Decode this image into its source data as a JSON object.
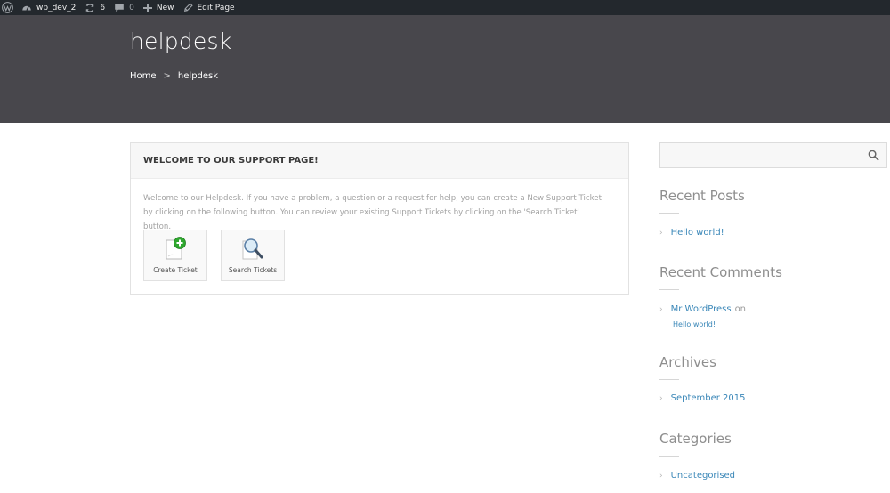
{
  "admin_bar": {
    "site_name": "wp_dev_2",
    "updates_count": "6",
    "comments_count": "0",
    "new_label": "New",
    "edit_label": "Edit Page"
  },
  "hero": {
    "title": "helpdesk",
    "breadcrumb": [
      "Home",
      "helpdesk"
    ],
    "separator": ">"
  },
  "welcome": {
    "heading": "WELCOME TO OUR SUPPORT PAGE!",
    "body": "Welcome to our Helpdesk. If you have a problem, a question or a request for help, you can create a New Support Ticket by clicking on the following button. You can review your existing Support Tickets by clicking on the 'Search Ticket' button.",
    "create_label": "Create Ticket",
    "search_label": "Search Tickets"
  },
  "sidebar": {
    "search_placeholder": "",
    "recent_posts_title": "Recent Posts",
    "recent_posts": [
      "Hello world!"
    ],
    "recent_comments_title": "Recent Comments",
    "comment_author": "Mr WordPress",
    "comment_on": "on",
    "comment_post": "Hello world!",
    "archives_title": "Archives",
    "archives": [
      "September 2015"
    ],
    "categories_title": "Categories",
    "categories": [
      "Uncategorised"
    ]
  },
  "colors": {
    "admin_bar_bg": "#23282d",
    "hero_bg": "#48474c",
    "link": "#3a87b8",
    "add_badge": "#2fa82f"
  }
}
